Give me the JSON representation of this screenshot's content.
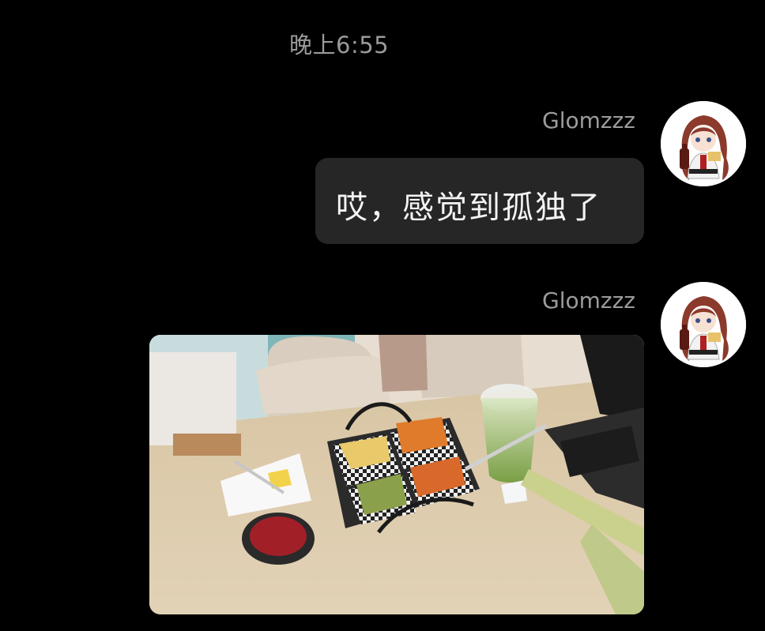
{
  "chat": {
    "timestamp": "晚上6:55",
    "messages": [
      {
        "sender": "Glomzzz",
        "type": "text",
        "text": "哎，感觉到孤独了",
        "avatar_icon": "anime-girl-avatar-icon"
      },
      {
        "sender": "Glomzzz",
        "type": "image",
        "image_description_icon": "food-photo-icon",
        "avatar_icon": "anime-girl-avatar-icon"
      }
    ]
  },
  "colors": {
    "background": "#000000",
    "bubble": "#262626",
    "text_primary": "#f4f4f4",
    "text_secondary": "#9c9c9c"
  }
}
